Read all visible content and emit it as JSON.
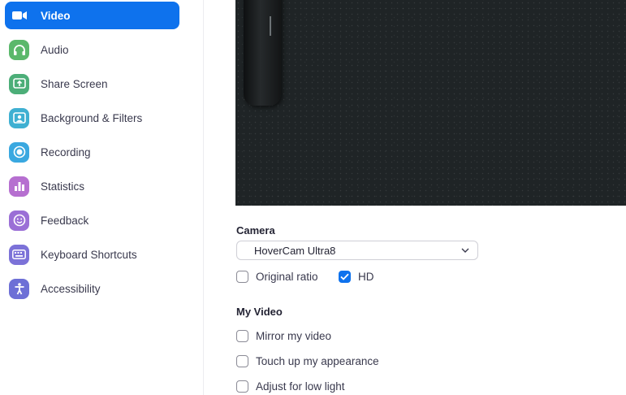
{
  "sidebar": {
    "items": [
      {
        "label": "Video",
        "icon": "video-camera-icon",
        "color": "#0e72ed",
        "active": true
      },
      {
        "label": "Audio",
        "icon": "headphones-icon",
        "color": "#5bb86b"
      },
      {
        "label": "Share Screen",
        "icon": "share-screen-icon",
        "color": "#4cae78"
      },
      {
        "label": "Background & Filters",
        "icon": "background-icon",
        "color": "#3fb0d2"
      },
      {
        "label": "Recording",
        "icon": "recording-icon",
        "color": "#3aa8e0"
      },
      {
        "label": "Statistics",
        "icon": "statistics-icon",
        "color": "#b66fd0"
      },
      {
        "label": "Feedback",
        "icon": "feedback-icon",
        "color": "#9b6fd6"
      },
      {
        "label": "Keyboard Shortcuts",
        "icon": "keyboard-icon",
        "color": "#7c72d8"
      },
      {
        "label": "Accessibility",
        "icon": "accessibility-icon",
        "color": "#6d6fd6"
      }
    ]
  },
  "camera": {
    "title": "Camera",
    "selected": "HoverCam Ultra8",
    "original_ratio_label": "Original ratio",
    "original_ratio_checked": false,
    "hd_label": "HD",
    "hd_checked": true
  },
  "my_video": {
    "title": "My Video",
    "options": [
      {
        "label": "Mirror my video",
        "checked": false
      },
      {
        "label": "Touch up my appearance",
        "checked": false
      },
      {
        "label": "Adjust for low light",
        "checked": false
      }
    ]
  }
}
